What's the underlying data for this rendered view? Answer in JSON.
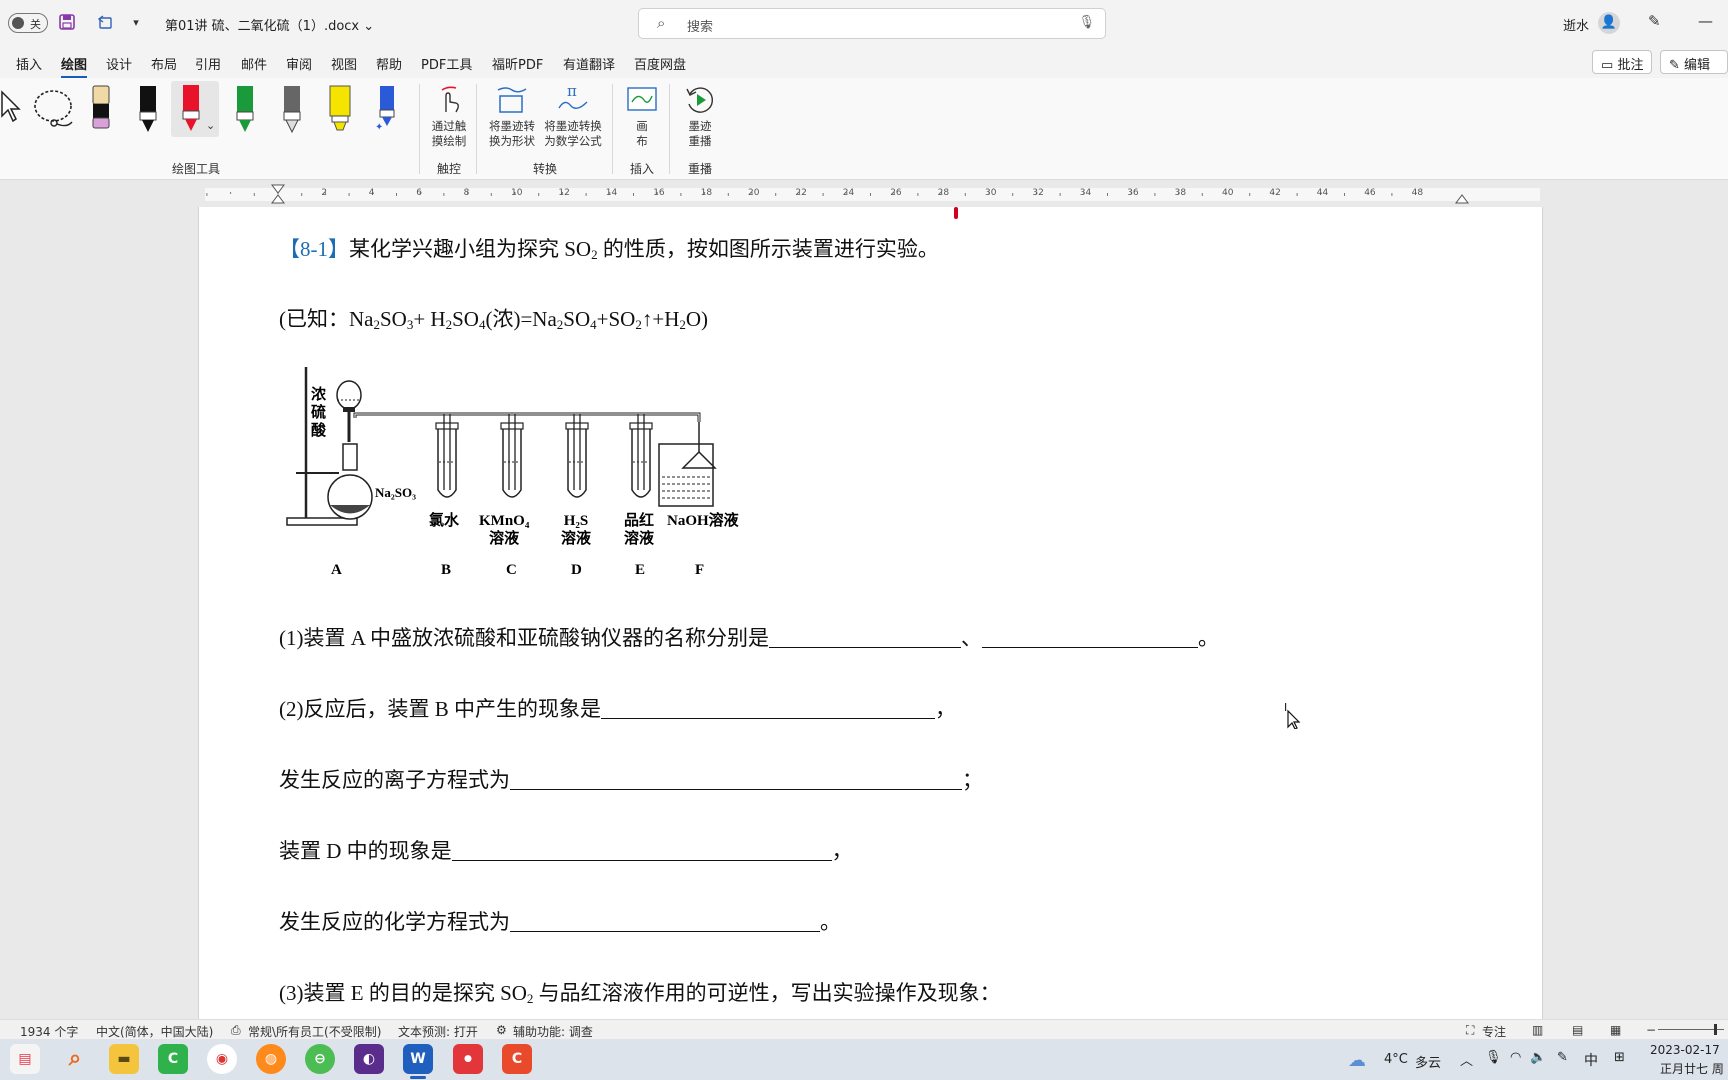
{
  "titlebar": {
    "autosave_label": "关",
    "doc_title": "第01讲 硫、二氧化硫（1）.docx",
    "search_placeholder": "搜索",
    "user_name": "逝水"
  },
  "tabs": [
    {
      "label": "插入"
    },
    {
      "label": "绘图"
    },
    {
      "label": "设计"
    },
    {
      "label": "布局"
    },
    {
      "label": "引用"
    },
    {
      "label": "邮件"
    },
    {
      "label": "审阅"
    },
    {
      "label": "视图"
    },
    {
      "label": "帮助"
    },
    {
      "label": "PDF工具"
    },
    {
      "label": "福昕PDF"
    },
    {
      "label": "有道翻译"
    },
    {
      "label": "百度网盘"
    }
  ],
  "active_tab": "绘图",
  "tab_buttons": {
    "comment": "批注",
    "edit": "编辑"
  },
  "ribbon": {
    "groups": {
      "draw_tools": "绘图工具",
      "touch": "触控",
      "convert": "转换",
      "insert": "插入",
      "replay": "重播"
    },
    "buttons": {
      "touch_draw": [
        "通过触",
        "摸绘制"
      ],
      "ink_to_shape": [
        "将墨迹转",
        "换为形状"
      ],
      "ink_to_math": [
        "将墨迹转换",
        "为数学公式"
      ],
      "canvas": [
        "画",
        "布"
      ],
      "ink_replay": [
        "墨迹",
        "重播"
      ]
    },
    "pen_colors": [
      "#000000",
      "#e8132a",
      "#1b9a3b",
      "#555555",
      "#f5e400",
      "#2a5ad8"
    ],
    "active_pen_color": "#e8132a"
  },
  "ruler": {
    "numbers": [
      "2",
      "4",
      "6",
      "8",
      "10",
      "12",
      "14",
      "16",
      "18",
      "20",
      "22",
      "24",
      "26",
      "28",
      "30",
      "32",
      "34",
      "36",
      "38",
      "40",
      "42",
      "44",
      "46",
      "48"
    ]
  },
  "document": {
    "q_label": "【8-1】",
    "q_intro": "某化学兴趣小组为探究 SO",
    "q_intro_sub": "2",
    "q_intro_rest": " 的性质，按如图所示装置进行实验。",
    "known": [
      "(已知：Na",
      "2",
      "SO",
      "3",
      "+ H",
      "2",
      "SO",
      "4",
      "(浓)=Na",
      "2",
      "SO",
      "4",
      "+SO",
      "2",
      "↑+H",
      "2",
      "O)"
    ],
    "figure": {
      "acid_label": [
        "浓",
        "硫",
        "酸"
      ],
      "flask_label": "Na₂SO₃",
      "tube_labels": [
        [
          "氯水"
        ],
        [
          "KMnO₄",
          "溶液"
        ],
        [
          "H₂S",
          "溶液"
        ],
        [
          "品红",
          "溶液"
        ],
        [
          "NaOH溶液"
        ]
      ],
      "letters": [
        "A",
        "B",
        "C",
        "D",
        "E",
        "F"
      ]
    },
    "q1": [
      "(1)装置 A 中盛放浓硫酸和亚硫酸钠仪器的名称分别是",
      "、",
      "。"
    ],
    "q2a": [
      "(2)反应后，装置 B 中产生的现象是",
      "，"
    ],
    "q2b": [
      "发生反应的离子方程式为",
      "；"
    ],
    "q2c": [
      "装置 D 中的现象是",
      "，"
    ],
    "q2d": [
      "发生反应的化学方程式为",
      "。"
    ],
    "q3": [
      "(3)装置 E 的目的是探究 SO",
      "2",
      " 与品红溶液作用的可逆性，写出实验操作及现象："
    ]
  },
  "statusbar": {
    "word_count": "1934 个字",
    "language": "中文(简体，中国大陆)",
    "sensitivity": "常规\\所有员工(不受限制)",
    "text_prediction": "文本预测: 打开",
    "accessibility": "辅助功能: 调查",
    "focus": "专注"
  },
  "taskbar": {
    "weather_temp": "4°C",
    "weather_desc": "多云",
    "ime": "中",
    "date": "2023-02-17",
    "lunar": "正月廿七 周五"
  }
}
